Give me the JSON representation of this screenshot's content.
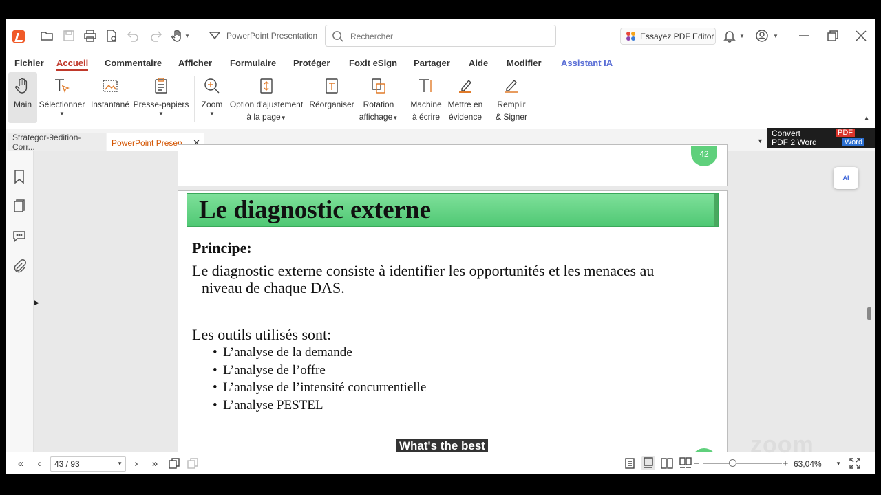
{
  "titlebar": {
    "document_title": "PowerPoint Presentation",
    "search_placeholder": "Rechercher",
    "pdf_editor_label": "Essayez PDF Editor"
  },
  "menu": {
    "items": [
      "Fichier",
      "Accueil",
      "Commentaire",
      "Afficher",
      "Formulaire",
      "Protéger",
      "Foxit eSign",
      "Partager",
      "Aide",
      "Modifier",
      "Assistant IA"
    ],
    "active": "Accueil"
  },
  "ribbon": {
    "main": "Main",
    "select": "Sélectionner",
    "snapshot": "Instantané",
    "clipboard": "Presse-papiers",
    "zoom": "Zoom",
    "fit_line1": "Option d'ajustement",
    "fit_line2": "à la page",
    "reorganize": "Réorganiser",
    "rotate_line1": "Rotation",
    "rotate_line2": "affichage",
    "typewriter_line1": "Machine",
    "typewriter_line2": "à écrire",
    "highlight_line1": "Mettre en",
    "highlight_line2": "évidence",
    "fillsign_line1": "Remplir",
    "fillsign_line2": "& Signer"
  },
  "tabs": [
    {
      "label": "Strategor-9edition-Corr...",
      "active": false
    },
    {
      "label": "PowerPoint Presen...",
      "active": true
    }
  ],
  "convert": {
    "line1": "Convert",
    "line2": "PDF 2 Word",
    "pdf_badge": "PDF",
    "word_badge": "Word"
  },
  "ai_badge": "AI",
  "previous_page_number": "42",
  "slide": {
    "title": "Le diagnostic externe",
    "principe": "Principe:",
    "para_line1": "Le diagnostic externe consiste à identifier les opportunités et les menaces au",
    "para_line2": "niveau de chaque DAS.",
    "tools_heading": "Les outils utilisés sont:",
    "bullets": [
      "L’analyse de la demande",
      "L’analyse de l’offre",
      "L’analyse de l’intensité concurrentielle",
      "L’analyse PESTEL"
    ]
  },
  "caption": "What's the best",
  "status": {
    "page_indicator": "43 / 93",
    "zoom_value": "63,04%",
    "zoom_fraction": 0.38
  },
  "watermark": "zoom",
  "colors": {
    "accent": "#c0392b",
    "slide_green": "#5fd07c",
    "ai_blue": "#5b6fd6"
  }
}
